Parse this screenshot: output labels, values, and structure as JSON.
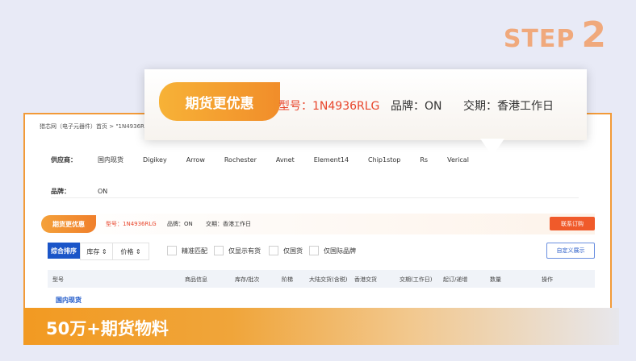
{
  "step": {
    "word": "STEP",
    "number": "2"
  },
  "breadcrumb": "猎芯网（电子元器件）首页  >  \"1N4936RL",
  "filters": {
    "supplier_label": "供应商：",
    "suppliers": [
      "国内现货",
      "Digikey",
      "Arrow",
      "Rochester",
      "Avnet",
      "Element14",
      "Chip1stop",
      "Rs",
      "Verical"
    ],
    "brand_label": "品牌：",
    "brand_value": "ON"
  },
  "promo_strip": {
    "tag": "期货更优惠",
    "model": "型号：1N4936RLG",
    "brand": "品牌：ON",
    "delivery": "交期：香港工作日",
    "contact_button": "联系订购"
  },
  "toolbar": {
    "sort_all": "综合排序",
    "sort_stock": "库存 ⇕",
    "sort_price": "价格 ⇕",
    "checks": [
      "精准匹配",
      "仅显示有货",
      "仅国货",
      "仅国际品牌"
    ],
    "custom_button": "自定义展示"
  },
  "table_headers": [
    "型号",
    "商品信息",
    "库存/批次",
    "阶梯",
    "大陆交货(含税)",
    "香港交货",
    "交期(工作日)",
    "起订/递增",
    "数量",
    "操作"
  ],
  "section_title": "国内现货",
  "popup": {
    "tag": "期货更优惠",
    "model": "型号：1N4936RLG",
    "brand": "品牌：ON",
    "delivery": "交期：香港工作日"
  },
  "banner_text": "50万+期货物料"
}
